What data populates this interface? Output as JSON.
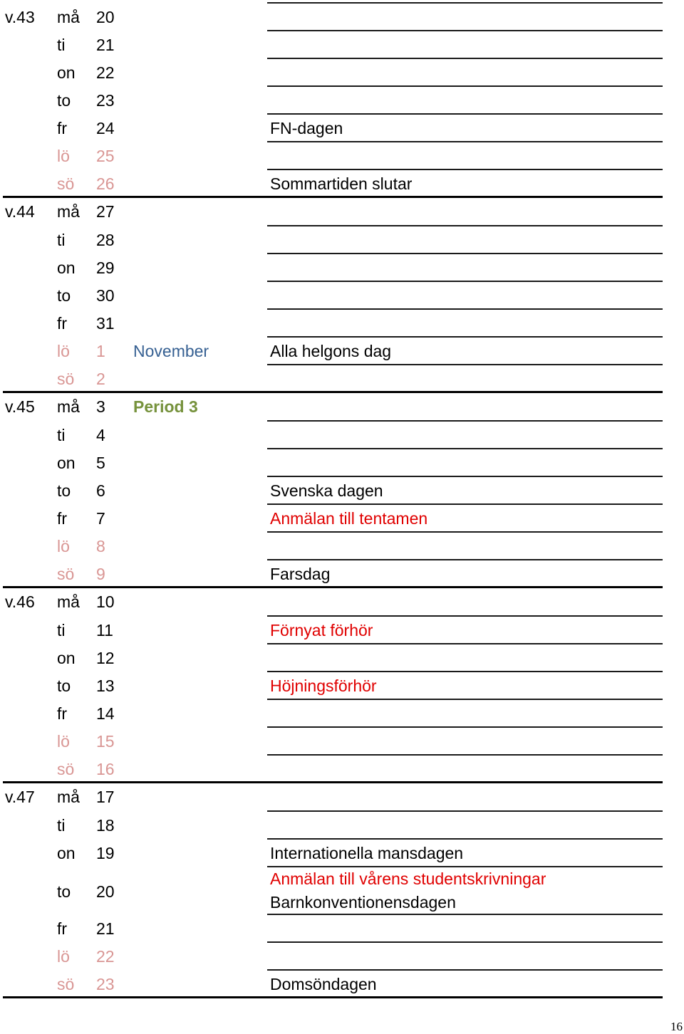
{
  "colors": {
    "weekday": "#000000",
    "weekend": "#d99694",
    "month_label": "#366092",
    "period_label": "#76923c",
    "note_red": "#e00000",
    "note_black": "#000000"
  },
  "weeks": [
    {
      "label": "v.43",
      "days": [
        {
          "day": "må",
          "date": "20",
          "weekend": false,
          "notes": []
        },
        {
          "day": "ti",
          "date": "21",
          "weekend": false,
          "notes": []
        },
        {
          "day": "on",
          "date": "22",
          "weekend": false,
          "notes": []
        },
        {
          "day": "to",
          "date": "23",
          "weekend": false,
          "notes": []
        },
        {
          "day": "fr",
          "date": "24",
          "weekend": false,
          "notes": [
            {
              "text": "FN-dagen",
              "color": "black"
            }
          ]
        },
        {
          "day": "lö",
          "date": "25",
          "weekend": true,
          "notes": []
        },
        {
          "day": "sö",
          "date": "26",
          "weekend": true,
          "notes": [
            {
              "text": "Sommartiden slutar",
              "color": "black"
            }
          ]
        }
      ]
    },
    {
      "label": "v.44",
      "days": [
        {
          "day": "må",
          "date": "27",
          "weekend": false,
          "notes": []
        },
        {
          "day": "ti",
          "date": "28",
          "weekend": false,
          "notes": []
        },
        {
          "day": "on",
          "date": "29",
          "weekend": false,
          "notes": []
        },
        {
          "day": "to",
          "date": "30",
          "weekend": false,
          "notes": []
        },
        {
          "day": "fr",
          "date": "31",
          "weekend": false,
          "notes": []
        },
        {
          "day": "lö",
          "date": "1",
          "weekend": true,
          "label": {
            "text": "November",
            "kind": "month"
          },
          "notes": [
            {
              "text": "Alla helgons dag",
              "color": "black"
            }
          ]
        },
        {
          "day": "sö",
          "date": "2",
          "weekend": true,
          "notes": []
        }
      ]
    },
    {
      "label": "v.45",
      "days": [
        {
          "day": "må",
          "date": "3",
          "weekend": false,
          "label": {
            "text": "Period 3",
            "kind": "period"
          },
          "notes": []
        },
        {
          "day": "ti",
          "date": "4",
          "weekend": false,
          "notes": []
        },
        {
          "day": "on",
          "date": "5",
          "weekend": false,
          "notes": []
        },
        {
          "day": "to",
          "date": "6",
          "weekend": false,
          "notes": [
            {
              "text": "Svenska dagen",
              "color": "black"
            }
          ]
        },
        {
          "day": "fr",
          "date": "7",
          "weekend": false,
          "notes": [
            {
              "text": "Anmälan till tentamen",
              "color": "red"
            }
          ]
        },
        {
          "day": "lö",
          "date": "8",
          "weekend": true,
          "notes": []
        },
        {
          "day": "sö",
          "date": "9",
          "weekend": true,
          "notes": [
            {
              "text": "Farsdag",
              "color": "black"
            }
          ]
        }
      ]
    },
    {
      "label": "v.46",
      "days": [
        {
          "day": "må",
          "date": "10",
          "weekend": false,
          "notes": []
        },
        {
          "day": "ti",
          "date": "11",
          "weekend": false,
          "notes": [
            {
              "text": "Förnyat förhör",
              "color": "red"
            }
          ]
        },
        {
          "day": "on",
          "date": "12",
          "weekend": false,
          "notes": []
        },
        {
          "day": "to",
          "date": "13",
          "weekend": false,
          "notes": [
            {
              "text": "Höjningsförhör",
              "color": "red"
            }
          ]
        },
        {
          "day": "fr",
          "date": "14",
          "weekend": false,
          "notes": []
        },
        {
          "day": "lö",
          "date": "15",
          "weekend": true,
          "notes": []
        },
        {
          "day": "sö",
          "date": "16",
          "weekend": true,
          "notes": []
        }
      ]
    },
    {
      "label": "v.47",
      "days": [
        {
          "day": "må",
          "date": "17",
          "weekend": false,
          "notes": []
        },
        {
          "day": "ti",
          "date": "18",
          "weekend": false,
          "notes": []
        },
        {
          "day": "on",
          "date": "19",
          "weekend": false,
          "notes": [
            {
              "text": "Internationella mansdagen",
              "color": "black"
            }
          ]
        },
        {
          "day": "to",
          "date": "20",
          "weekend": false,
          "notes": [
            {
              "text": "Anmälan till vårens studentskrivningar",
              "color": "red"
            },
            {
              "text": "Barnkonventionensdagen",
              "color": "black"
            }
          ]
        },
        {
          "day": "fr",
          "date": "21",
          "weekend": false,
          "notes": []
        },
        {
          "day": "lö",
          "date": "22",
          "weekend": true,
          "notes": []
        },
        {
          "day": "sö",
          "date": "23",
          "weekend": true,
          "notes": [
            {
              "text": "Domsöndagen",
              "color": "black"
            }
          ]
        }
      ]
    }
  ],
  "page_number": "16"
}
